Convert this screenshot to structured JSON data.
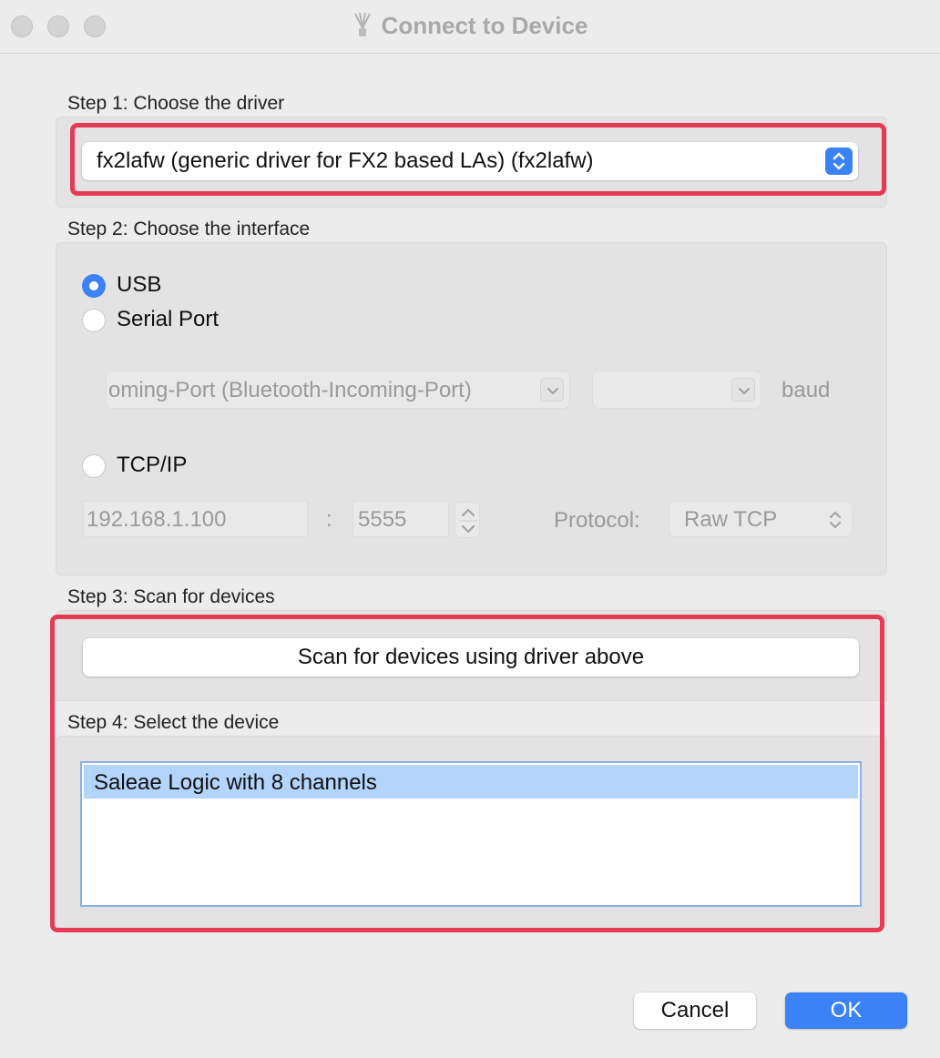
{
  "window": {
    "title": "Connect to Device",
    "app_icon": "sigrok-app-icon"
  },
  "step1": {
    "label": "Step 1: Choose the driver",
    "driver_selected": "fx2lafw (generic driver for FX2 based LAs) (fx2lafw)"
  },
  "step2": {
    "label": "Step 2: Choose the interface",
    "usb_label": "USB",
    "serial_label": "Serial Port",
    "serial_port_value": "oming-Port (Bluetooth-Incoming-Port)",
    "baud_value": "",
    "baud_label": "baud",
    "tcp_label": "TCP/IP",
    "host_value": "192.168.1.100",
    "colon": ":",
    "port_value": "5555",
    "protocol_label": "Protocol:",
    "protocol_value": "Raw TCP",
    "selected_interface": "USB"
  },
  "step3": {
    "label": "Step 3: Scan for devices",
    "scan_button": "Scan for devices using driver above"
  },
  "step4": {
    "label": "Step 4: Select the device",
    "devices": [
      "Saleae Logic with 8 channels"
    ],
    "selected_index": 0
  },
  "buttons": {
    "cancel": "Cancel",
    "ok": "OK"
  },
  "colors": {
    "accent": "#3b82f6",
    "highlight_annotation": "#e63a56",
    "selection": "#b3d4fb"
  }
}
